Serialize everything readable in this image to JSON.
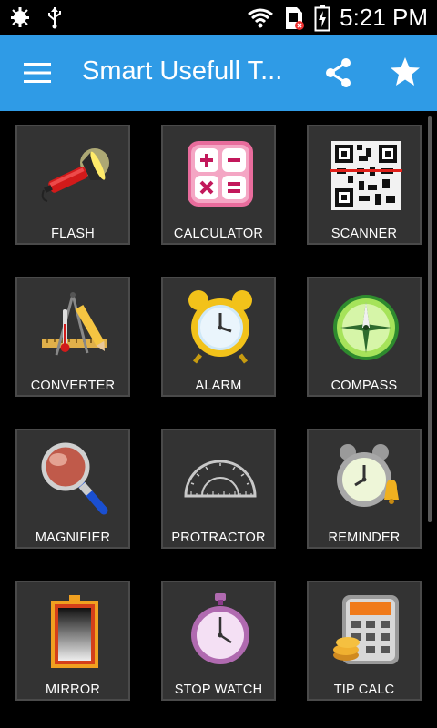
{
  "status_bar": {
    "time": "5:21 PM"
  },
  "app_bar": {
    "title": "Smart Usefull T..."
  },
  "tools": [
    {
      "label": "FLASH"
    },
    {
      "label": "CALCULATOR"
    },
    {
      "label": "SCANNER"
    },
    {
      "label": "CONVERTER"
    },
    {
      "label": "ALARM"
    },
    {
      "label": "COMPASS"
    },
    {
      "label": "MAGNIFIER"
    },
    {
      "label": "PROTRACTOR"
    },
    {
      "label": "REMINDER"
    },
    {
      "label": "MIRROR"
    },
    {
      "label": "STOP WATCH"
    },
    {
      "label": "TIP CALC"
    }
  ],
  "colors": {
    "app_bar": "#2f9be6",
    "tile": "#333333",
    "background": "#000000"
  }
}
